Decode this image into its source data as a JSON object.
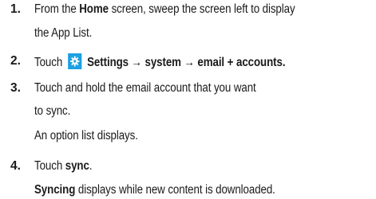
{
  "steps": [
    {
      "number": "1.",
      "line1": {
        "pre": "From the ",
        "bold": "Home",
        "post": " screen, sweep the screen left to display"
      },
      "line2": "the App List."
    },
    {
      "number": "2.",
      "pre": "Touch",
      "icon": "settings-gear-icon",
      "bold": "Settings → system → email + accounts."
    },
    {
      "number": "3.",
      "line1": "Touch and hold the email account that you want",
      "line2": "to sync.",
      "note": "An option list displays."
    },
    {
      "number": "4.",
      "pre": "Touch ",
      "bold": "sync",
      "post": ".",
      "note_bold": "Syncing",
      "note_post": " displays while new content is downloaded."
    }
  ],
  "colors": {
    "text": "#1a1a1a",
    "icon_tile": "#1ba1e2",
    "icon_glyph": "#ffffff"
  }
}
